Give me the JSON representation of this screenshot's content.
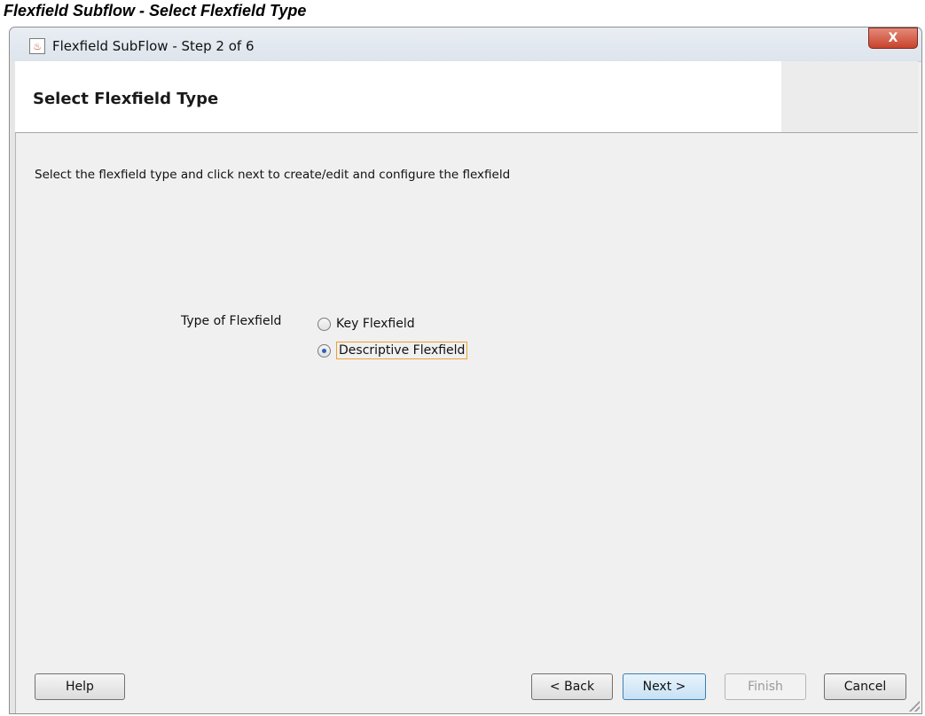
{
  "caption": "Flexfield Subflow - Select Flexfield Type",
  "window": {
    "title": "Flexfield SubFlow - Step 2 of 6",
    "close_label": "X"
  },
  "header": {
    "title": "Select Flexfield Type"
  },
  "instruction": "Select the flexfield type and click next to create/edit and configure the flexfield",
  "form": {
    "type_label": "Type of Flexfield",
    "options": [
      {
        "label": "Key Flexfield",
        "selected": false
      },
      {
        "label": "Descriptive Flexfield",
        "selected": true
      }
    ]
  },
  "buttons": {
    "help": "Help",
    "back": "< Back",
    "next": "Next >",
    "finish": "Finish",
    "cancel": "Cancel"
  },
  "colors": {
    "dialog_bg": "#f0f0f0",
    "close_button": "#c8432c",
    "focus_outline": "#f0a030",
    "radio_dot": "#2f62b8"
  }
}
